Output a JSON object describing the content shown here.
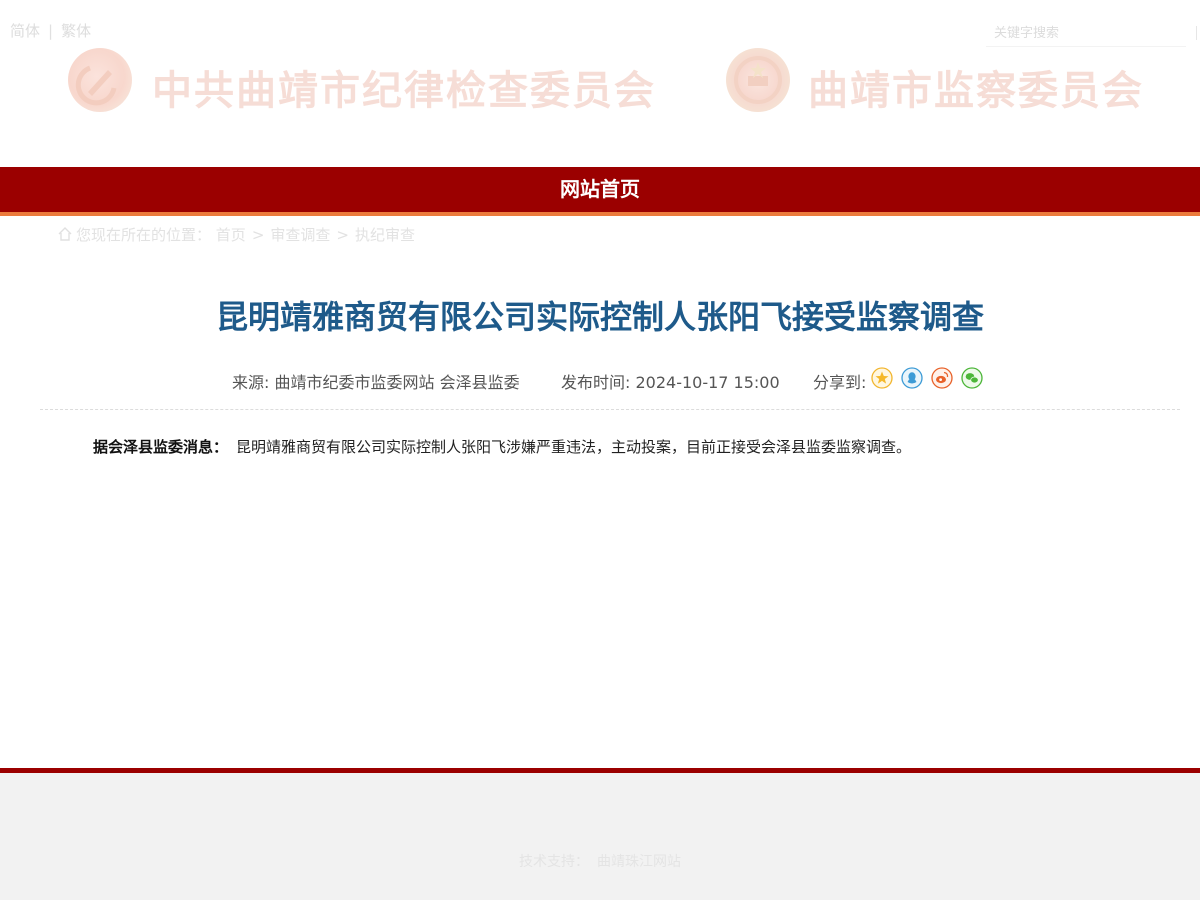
{
  "lang": {
    "simplified": "简体",
    "separator": "|",
    "traditional": "繁体"
  },
  "search": {
    "placeholder": "关键字搜索"
  },
  "banner": {
    "left_title": "中共曲靖市纪律检查委员会",
    "right_title": "曲靖市监察委员会"
  },
  "nav": {
    "home": "网站首页"
  },
  "breadcrumb": {
    "prefix": "您现在所在的位置：",
    "items": [
      "首页",
      "审查调查",
      "执纪审查"
    ],
    "arrow": ">"
  },
  "article": {
    "title": "昆明靖雅商贸有限公司实际控制人张阳飞接受监察调查",
    "source": "来源: 曲靖市纪委市监委网站 会泽县监委",
    "published": "发布时间: 2024-10-17 15:00",
    "share_label": "分享到:",
    "share_icons": [
      "qzone-icon",
      "qq-icon",
      "weibo-icon",
      "wechat-icon"
    ],
    "lead": "据会泽县监委消息：",
    "body": "昆明靖雅商贸有限公司实际控制人张阳飞涉嫌严重违法，主动投案，目前正接受会泽县监委监察调查。"
  },
  "footer": {
    "label": "技术支持：",
    "value": "曲靖珠江网站"
  },
  "colors": {
    "brand_red": "#9b0000",
    "accent_orange": "#ec7b3c",
    "title_blue": "#1e5a8a"
  }
}
